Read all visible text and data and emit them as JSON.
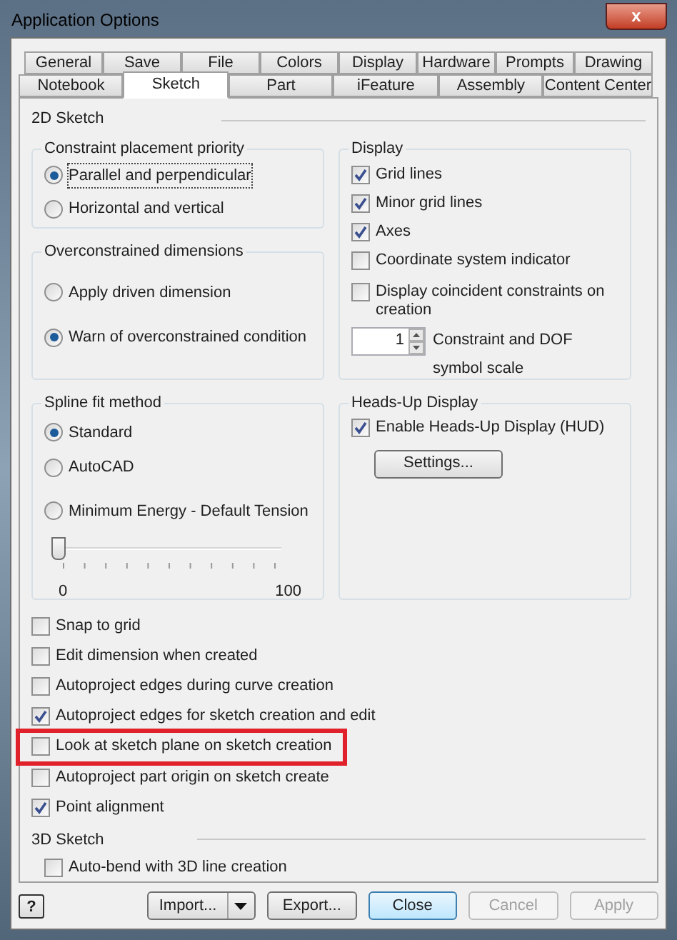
{
  "window": {
    "title": "Application Options",
    "close_glyph": "x"
  },
  "tabs": [
    [
      {
        "label": "General",
        "selected": false
      },
      {
        "label": "Save",
        "selected": false
      },
      {
        "label": "File",
        "selected": false
      },
      {
        "label": "Colors",
        "selected": false
      },
      {
        "label": "Display",
        "selected": false
      },
      {
        "label": "Hardware",
        "selected": false
      },
      {
        "label": "Prompts",
        "selected": false
      },
      {
        "label": "Drawing",
        "selected": false
      }
    ],
    [
      {
        "label": "Notebook",
        "selected": false
      },
      {
        "label": "Sketch",
        "selected": true
      },
      {
        "label": "Part",
        "selected": false
      },
      {
        "label": "iFeature",
        "selected": false
      },
      {
        "label": "Assembly",
        "selected": false
      },
      {
        "label": "Content Center",
        "selected": false
      }
    ]
  ],
  "section_2d": "2D Sketch",
  "constraint_priority": {
    "title": "Constraint placement priority",
    "options": [
      {
        "label": "Parallel and perpendicular",
        "selected": true
      },
      {
        "label": "Horizontal and vertical",
        "selected": false
      }
    ]
  },
  "overconstrained": {
    "title": "Overconstrained dimensions",
    "options": [
      {
        "label": "Apply driven dimension",
        "selected": false
      },
      {
        "label": "Warn of overconstrained condition",
        "selected": true
      }
    ]
  },
  "display": {
    "title": "Display",
    "options": [
      {
        "label": "Grid lines",
        "checked": true
      },
      {
        "label": "Minor grid lines",
        "checked": true
      },
      {
        "label": "Axes",
        "checked": true
      },
      {
        "label": "Coordinate system indicator",
        "checked": false
      },
      {
        "label": "Display coincident constraints on creation",
        "checked": false
      }
    ],
    "symbol_scale": {
      "value": "1",
      "label": "Constraint and DOF symbol scale"
    }
  },
  "spline_fit": {
    "title": "Spline fit method",
    "options": [
      {
        "label": "Standard",
        "selected": true
      },
      {
        "label": "AutoCAD",
        "selected": false
      },
      {
        "label": "Minimum Energy - Default Tension",
        "selected": false
      }
    ],
    "tension": {
      "level": 0,
      "min_label": "0",
      "max_label": "100"
    }
  },
  "hud": {
    "title": "Heads-Up Display",
    "enable": {
      "label": "Enable Heads-Up Display (HUD)",
      "checked": true
    },
    "settings_button": "Settings..."
  },
  "sketch_options": [
    {
      "label": "Snap to grid",
      "checked": false,
      "highlighted": false
    },
    {
      "label": "Edit dimension when created",
      "checked": false,
      "highlighted": false
    },
    {
      "label": "Autoproject edges during curve creation",
      "checked": false,
      "highlighted": false
    },
    {
      "label": "Autoproject edges for sketch creation and edit",
      "checked": true,
      "highlighted": false
    },
    {
      "label": "Look at sketch plane on sketch creation",
      "checked": false,
      "highlighted": true
    },
    {
      "label": "Autoproject part origin on sketch create",
      "checked": false,
      "highlighted": false
    },
    {
      "label": "Point alignment",
      "checked": true,
      "highlighted": false
    }
  ],
  "section_3d": "3D Sketch",
  "sketch_3d_options": [
    {
      "label": "Auto-bend with 3D line creation",
      "checked": false
    }
  ],
  "footer": {
    "help_glyph": "?",
    "buttons": [
      {
        "label": "Import...",
        "kind": "split",
        "disabled": false,
        "default": false
      },
      {
        "label": "Export...",
        "kind": "plain",
        "disabled": false,
        "default": false
      },
      {
        "label": "Close",
        "kind": "plain",
        "disabled": false,
        "default": true
      },
      {
        "label": "Cancel",
        "kind": "plain",
        "disabled": true,
        "default": false
      },
      {
        "label": "Apply",
        "kind": "plain",
        "disabled": true,
        "default": false
      }
    ]
  }
}
